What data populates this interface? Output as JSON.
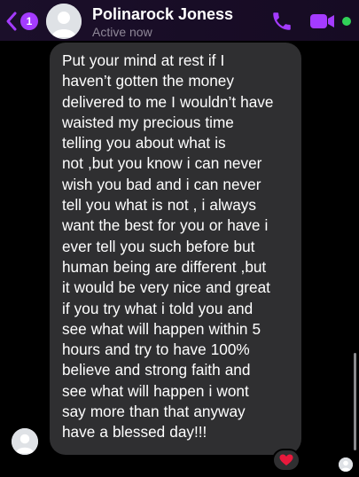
{
  "header": {
    "back_badge": "1",
    "contact_name": "Polinarock Joness",
    "status": "Active now",
    "accent_color": "#a43bff",
    "online_color": "#31d158",
    "icons": [
      "back-chevron-icon",
      "phone-icon",
      "video-camera-icon"
    ]
  },
  "message": {
    "text": "Put your mind at rest if I\nhaven’t gotten the money\ndelivered to me I wouldn’t have\nwaisted my precious time\ntelling you about what is\nnot ,but you know i can never\nwish you bad and i can never\ntell you what is not , i always\nwant the best for you or have i\never tell you such before but\nhuman being are different ,but\nit would be very nice and great\nif you try what i told you and\nsee what will happen within 5\nhours and try to have 100%\nbelieve and strong faith and\nsee what will happen  i wont\nsay more than that anyway\nhave a blessed day!!!",
    "reaction": "❤️",
    "bubble_color": "#2f2f31"
  }
}
